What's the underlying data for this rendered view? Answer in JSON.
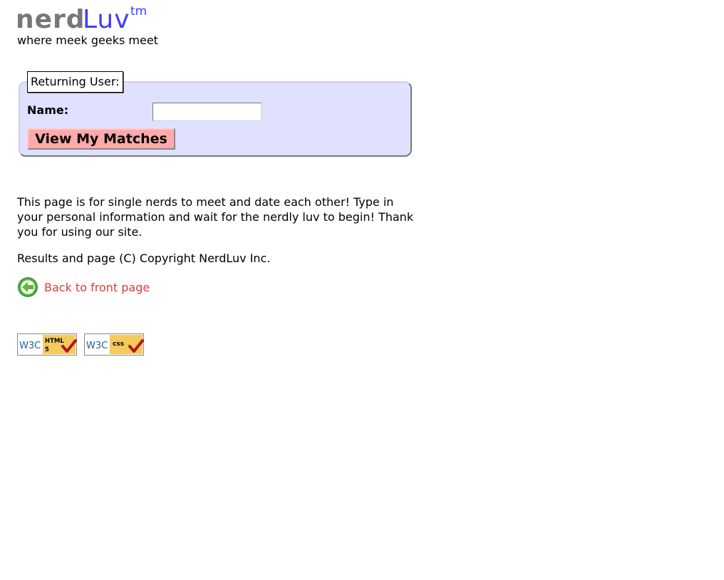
{
  "logo": {
    "part1": "nerd",
    "part2": "Luv",
    "trademark": "tm",
    "tagline": "where meek geeks meet"
  },
  "login": {
    "legend": "Returning User:",
    "name_label": "Name:",
    "name_value": "",
    "submit_label": "View My Matches"
  },
  "content": {
    "intro": "This page is for single nerds to meet and date each other! Type in your personal information and wait for the nerdly luv to begin! Thank you for using our site.",
    "copyright": "Results and page (C) Copyright NerdLuv Inc.",
    "back_link": "Back to front page",
    "back_icon": "back-arrow-icon"
  },
  "badges": {
    "html": {
      "w3c": "W3C",
      "label": "HTML",
      "version": "5"
    },
    "css": {
      "w3c": "W3C",
      "label": "css"
    }
  },
  "colors": {
    "brand_gray": "#777777",
    "brand_blue": "#3d3dff",
    "box_background": "#e0e0ff",
    "button_background": "#ffaaaa",
    "link": "#dd3b3b"
  }
}
